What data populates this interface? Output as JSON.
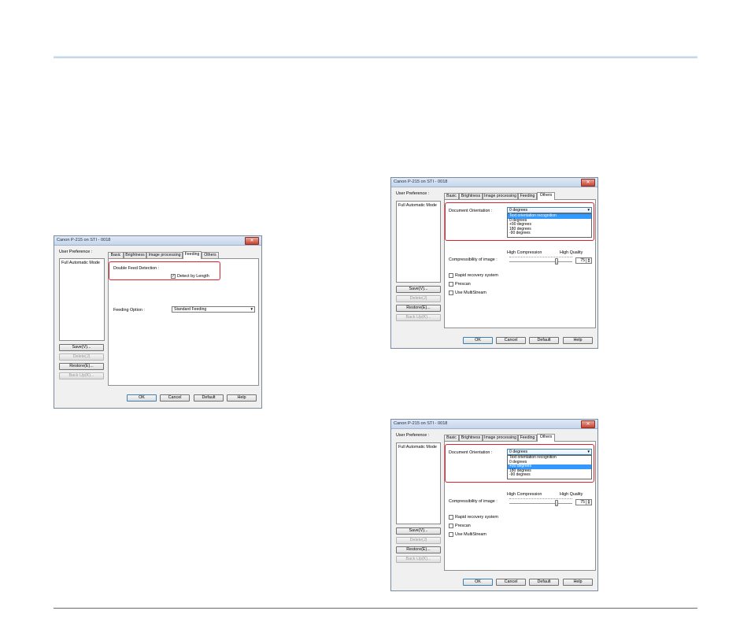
{
  "dialog_title": "Canon P-215 on STI - 0018",
  "user_preference_label": "User Preference :",
  "preference_items": [
    "Full Automatic Mode"
  ],
  "buttons": {
    "save": "Save(V)...",
    "delete": "Delete(J)",
    "restore": "Restore(E)...",
    "backup": "Back Up(K)...",
    "ok": "OK",
    "cancel": "Cancel",
    "default": "Default",
    "help": "Help"
  },
  "tabs": [
    "Basic",
    "Brightness",
    "Image processing",
    "Feeding",
    "Others"
  ],
  "feeding": {
    "double_feed_label": "Double Feed Detection :",
    "detect_by_length_label": "Detect by Length",
    "detect_by_length_checked": true,
    "feeding_option_label": "Feeding Option :",
    "feeding_option_value": "Standard Feeding"
  },
  "others": {
    "orientation_label": "Document Orientation :",
    "orientation_value": "0 degrees",
    "orientation_options": [
      "Text orientation recognition",
      "0 degrees",
      "+90 degrees",
      "180 degrees",
      "-90 degrees"
    ],
    "selected_option_dialog2": "Text orientation recognition",
    "selected_option_dialog3": "+90 degrees",
    "high_compression": "High Compression",
    "high_quality": "High Quality",
    "compressibility_label": "Compressibility of image :",
    "compressibility_value": "75",
    "rapid_recovery": "Rapid recovery system",
    "prescan": "Prescan",
    "multistream": "Use MultiStream"
  },
  "colors": {
    "highlight": "#e0202a",
    "selection": "#3399ff",
    "title_bar": "#c5d6ec",
    "close_button": "#c5432f"
  },
  "icons": {
    "close": "close-icon",
    "dropdown": "chevron-down-icon"
  }
}
